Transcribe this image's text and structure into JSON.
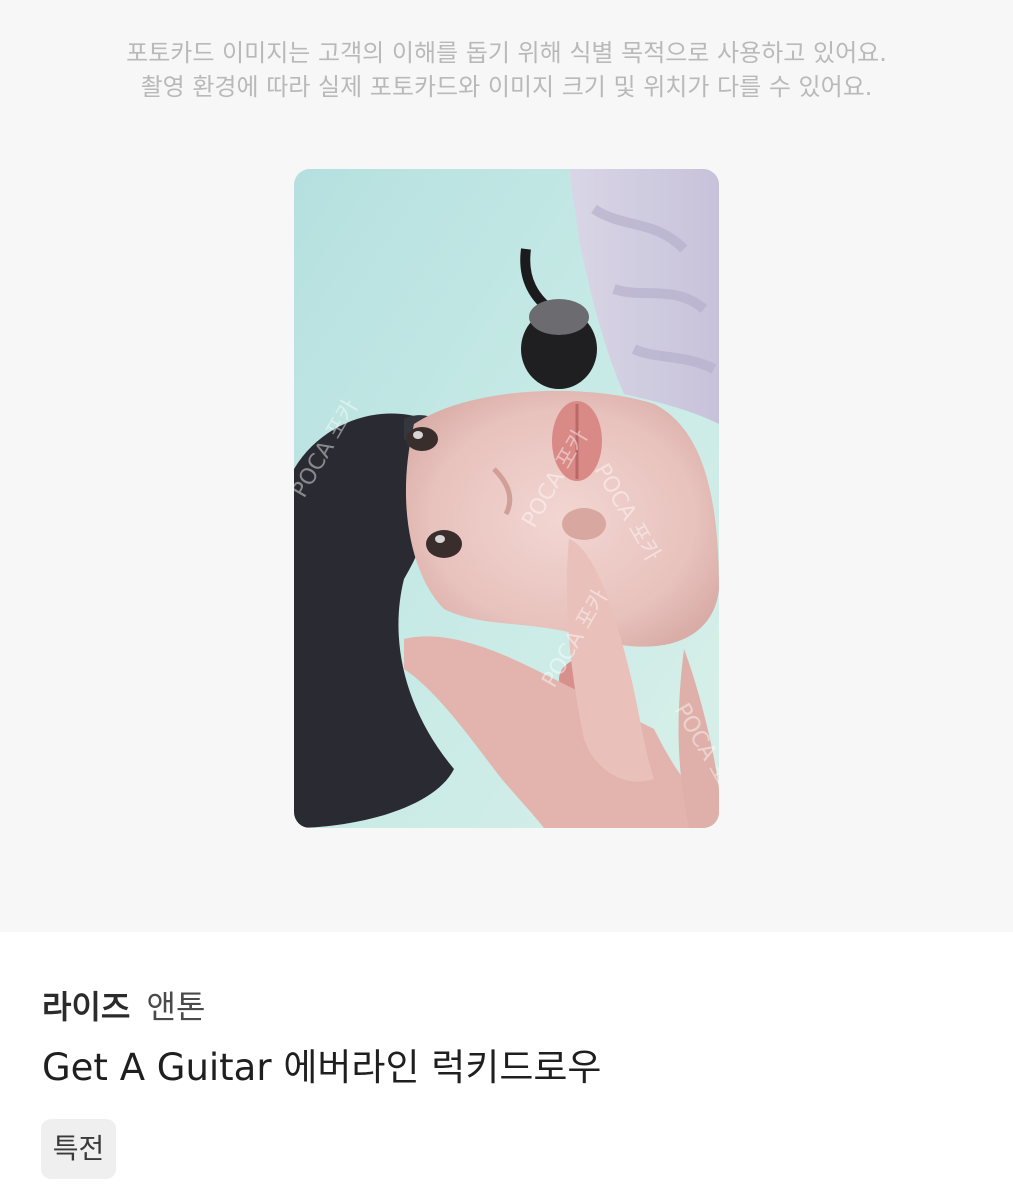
{
  "notice": {
    "line1": "포토카드 이미지는 고객의 이해를 돕기 위해 식별 목적으로 사용하고 있어요.",
    "line2": "촬영 환경에 따라 실제 포토카드와 이미지 크기 및 위치가 다를 수 있어요."
  },
  "photocard": {
    "watermark": "POCA 포카"
  },
  "product": {
    "artist": "라이즈",
    "member": "앤톤",
    "title": "Get A Guitar 에버라인 럭키드로우",
    "tag": "특전"
  }
}
